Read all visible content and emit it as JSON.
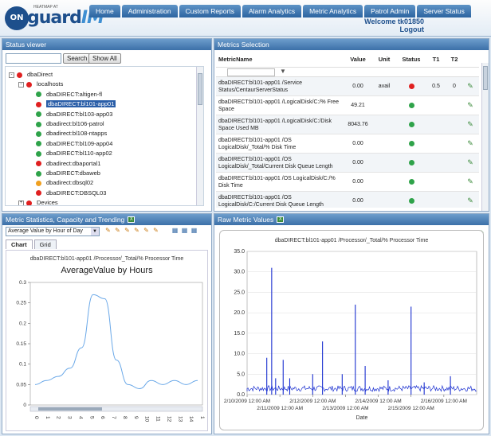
{
  "app": {
    "logo_on": "ON",
    "logo_guard": "guard",
    "logo_im": "IM",
    "logo_small": "HEATMAP AT",
    "nav": [
      "Home",
      "Administration",
      "Custom Reports",
      "Alarm Analytics",
      "Metric Analytics",
      "Patrol Admin",
      "Server Status"
    ],
    "welcome": "Welcome tk01850",
    "logout": "Logout"
  },
  "status_viewer": {
    "title": "Status viewer",
    "search_btn": "Search",
    "showall_btn": "Show All",
    "tree": [
      {
        "label": "dbaDirect",
        "level": 0,
        "color": "#e02020",
        "expander": "-"
      },
      {
        "label": "localhosts",
        "level": 1,
        "color": "#e02020",
        "expander": "-"
      },
      {
        "label": "dbaDIRECT:altigen-fl",
        "level": 2,
        "color": "#2fa34a"
      },
      {
        "label": "dbaDIRECT:bl101-app01",
        "level": 2,
        "color": "#e02020",
        "selected": true
      },
      {
        "label": "dbaDIRECT:bl103-app03",
        "level": 2,
        "color": "#2fa34a"
      },
      {
        "label": "dbadirect:bl106-patrol",
        "level": 2,
        "color": "#2fa34a"
      },
      {
        "label": "dbadirect:bl108-ntapps",
        "level": 2,
        "color": "#2fa34a"
      },
      {
        "label": "dbaDIRECT:bl109-app04",
        "level": 2,
        "color": "#2fa34a"
      },
      {
        "label": "dbaDIRECT:bl110-app02",
        "level": 2,
        "color": "#2fa34a"
      },
      {
        "label": "dbadirect:dbaportal1",
        "level": 2,
        "color": "#e02020"
      },
      {
        "label": "dbaDIRECT:dbaweb",
        "level": 2,
        "color": "#2fa34a"
      },
      {
        "label": "dbadirect:dbsql02",
        "level": 2,
        "color": "#f0a020"
      },
      {
        "label": "dbaDIRECT:DBSQL03",
        "level": 2,
        "color": "#e02020"
      },
      {
        "label": "Devices",
        "level": 1,
        "color": "#e02020",
        "expander": "+"
      }
    ]
  },
  "metrics": {
    "title": "Metrics Selection",
    "headers": {
      "name": "MetricName",
      "value": "Value",
      "unit": "Unit",
      "status": "Status",
      "t1": "T1",
      "t2": "T2"
    },
    "rows": [
      {
        "name": "dbaDIRECT:bl101-app01 /Service Status/CentaurServerStatus",
        "value": "0.00",
        "unit": "avail",
        "color": "#e02020",
        "t1": "0.5",
        "t2": "0"
      },
      {
        "name": "dbaDIRECT:bl101-app01 /LogicalDisk/C:/% Free Space",
        "value": "49.21",
        "unit": "",
        "color": "#2fa34a",
        "t1": "",
        "t2": ""
      },
      {
        "name": "dbaDIRECT:bl101-app01 /LogicalDisk/C:/Disk Space Used MB",
        "value": "8043.76",
        "unit": "",
        "color": "#2fa34a",
        "t1": "",
        "t2": ""
      },
      {
        "name": "dbaDIRECT:bl101-app01 /OS LogicalDisk/_Total/% Disk Time",
        "value": "0.00",
        "unit": "",
        "color": "#2fa34a",
        "t1": "",
        "t2": ""
      },
      {
        "name": "dbaDIRECT:bl101-app01 /OS LogicalDisk/_Total/Current Disk Queue Length",
        "value": "0.00",
        "unit": "",
        "color": "#2fa34a",
        "t1": "",
        "t2": ""
      },
      {
        "name": "dbaDIRECT:bl101-app01 /OS LogicalDisk/C:/% Disk Time",
        "value": "0.00",
        "unit": "",
        "color": "#2fa34a",
        "t1": "",
        "t2": ""
      },
      {
        "name": "dbaDIRECT:bl101-app01 /OS LogicalDisk/C:/Current Disk Queue Length",
        "value": "0.00",
        "unit": "",
        "color": "#2fa34a",
        "t1": "",
        "t2": ""
      }
    ]
  },
  "stats": {
    "title": "Metric Statistics, Capacity and Trending",
    "select_value": "Average Value by Hour of Day",
    "tab_chart": "Chart",
    "tab_grid": "Grid"
  },
  "raw": {
    "title": "Raw Metric Values"
  },
  "chart_data": [
    {
      "type": "line",
      "title": "dbaDIRECT:bl101-app01 /Processor/_Total/% Processor Time",
      "subtitle": "AverageValue by Hours",
      "x": [
        0,
        1,
        2,
        3,
        4,
        5,
        6,
        7,
        8,
        9,
        10,
        11,
        12,
        13,
        14
      ],
      "series": [
        {
          "values": [
            0.05,
            0.06,
            0.07,
            0.09,
            0.14,
            0.27,
            0.26,
            0.11,
            0.05,
            0.04,
            0.06,
            0.05,
            0.06,
            0.05,
            0.06
          ]
        }
      ],
      "ylim": [
        0,
        0.3
      ],
      "yticks": [
        "0",
        "0.05",
        "0.1",
        "0.15",
        "0.2",
        "0.25",
        "0.3"
      ],
      "xticks": [
        "0",
        "1",
        "2",
        "3",
        "4",
        "5",
        "6",
        "7",
        "8",
        "9",
        "10",
        "11",
        "12",
        "13",
        "14",
        "1"
      ]
    },
    {
      "type": "line",
      "title": "dbaDIRECT:bl101-app01 /Processor/_Total/% Processor Time",
      "xlabel": "Date",
      "ylim": [
        0,
        35
      ],
      "yticks": [
        "0.0",
        "5.0",
        "10.0",
        "15.0",
        "20.0",
        "25.0",
        "30.0",
        "35.0"
      ],
      "xticks_top": [
        "2/10/2009 12:00 AM",
        "2/12/2009 12:00 AM",
        "2/14/2009 12:00 AM",
        "2/16/2009 12:00 AM"
      ],
      "xticks_bottom": [
        "2/11/2009 12:00 AM",
        "2/13/2009 12:00 AM",
        "2/15/2009 12:00 AM"
      ],
      "x_range_days": [
        0,
        7
      ],
      "baseline": 0.8,
      "spikes": [
        [
          0.6,
          9.0
        ],
        [
          0.75,
          31.0
        ],
        [
          0.87,
          4.0
        ],
        [
          1.1,
          8.5
        ],
        [
          1.3,
          4.0
        ],
        [
          2.0,
          5.0
        ],
        [
          2.3,
          13.0
        ],
        [
          2.9,
          5.0
        ],
        [
          3.3,
          22.0
        ],
        [
          3.6,
          7.0
        ],
        [
          4.3,
          3.5
        ],
        [
          5.0,
          21.5
        ],
        [
          5.4,
          3.0
        ],
        [
          6.2,
          4.5
        ]
      ]
    }
  ]
}
